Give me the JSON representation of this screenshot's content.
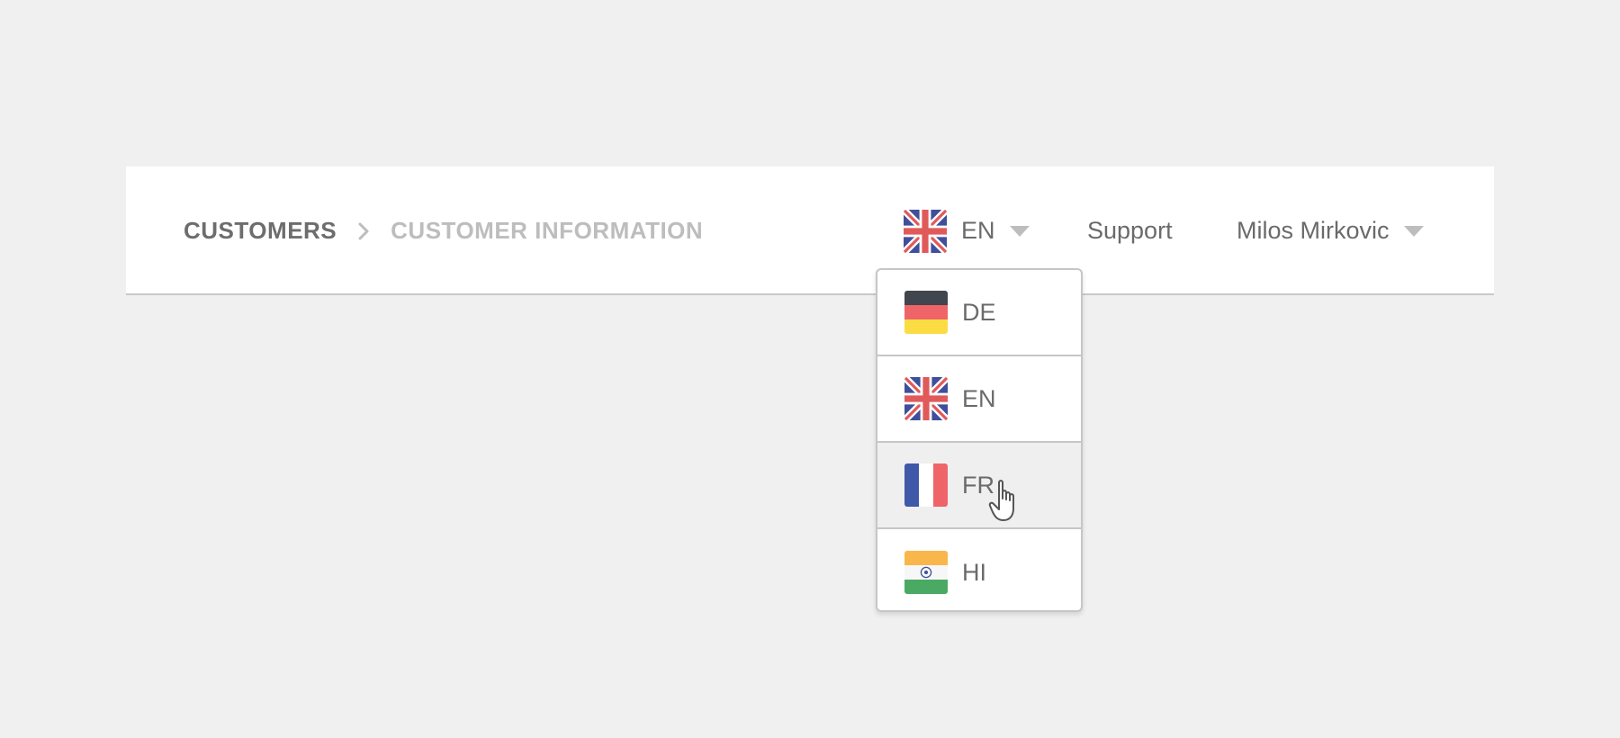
{
  "breadcrumb": {
    "root": "CUSTOMERS",
    "separator_icon": "chevron-right-icon",
    "current": "CUSTOMER INFORMATION"
  },
  "language_selector": {
    "current_code": "EN",
    "current_flag": "uk-flag-icon",
    "caret_icon": "caret-down-icon",
    "open": true
  },
  "nav": {
    "support_label": "Support",
    "user_name": "Milos Mirkovic",
    "user_caret_icon": "caret-down-icon"
  },
  "language_dropdown": {
    "items": [
      {
        "code": "DE",
        "flag": "germany-flag-icon"
      },
      {
        "code": "EN",
        "flag": "uk-flag-icon"
      },
      {
        "code": "FR",
        "flag": "france-flag-icon",
        "hovered": true
      },
      {
        "code": "HI",
        "flag": "india-flag-icon"
      }
    ]
  },
  "colors": {
    "background": "#f0f0f0",
    "bar": "#ffffff",
    "text": "#6a6a6a",
    "muted": "#bdbdbd",
    "hover": "#efefef"
  }
}
